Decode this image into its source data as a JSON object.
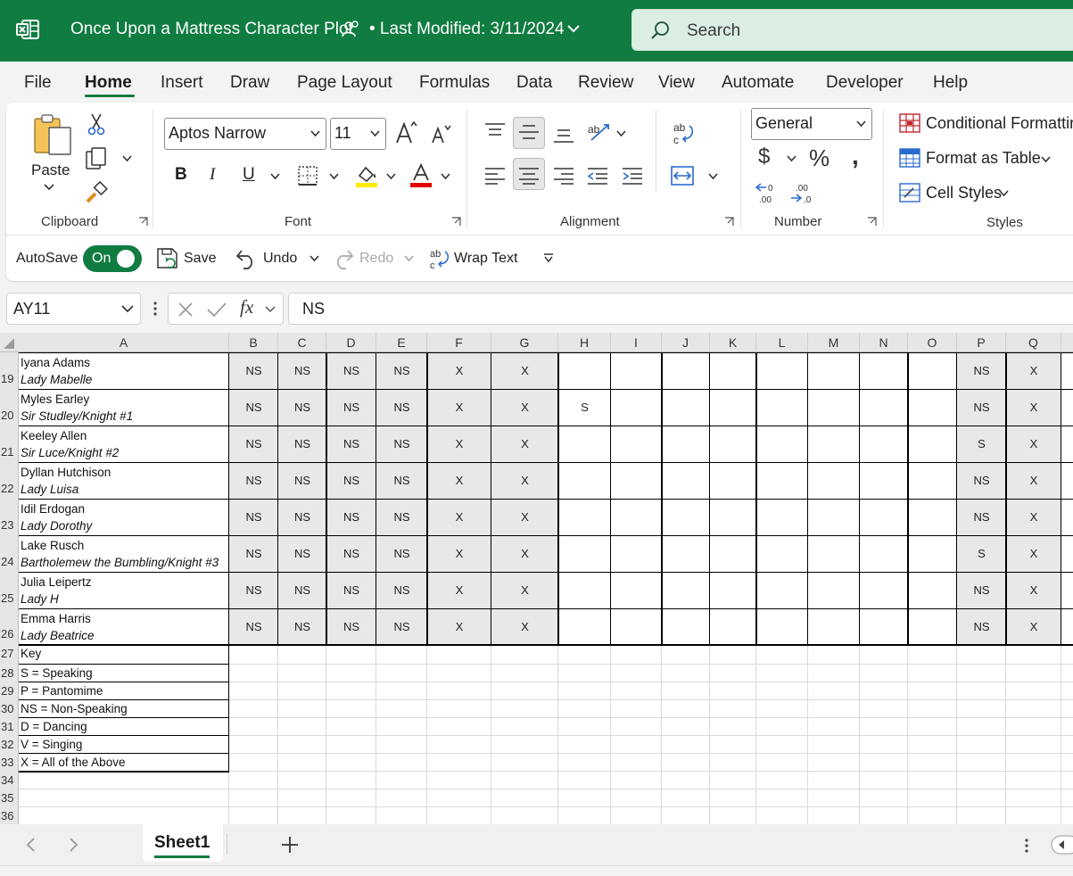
{
  "colors": {
    "brand": "#107c41",
    "shade": "#e8e8e8"
  },
  "titlebar": {
    "app_icon": "excel-icon",
    "title": "Once Upon a Mattress Character Plot",
    "modified": "• Last Modified: 3/11/2024",
    "search_placeholder": "Search"
  },
  "menu": [
    "File",
    "Home",
    "Insert",
    "Draw",
    "Page Layout",
    "Formulas",
    "Data",
    "Review",
    "View",
    "Automate",
    "Developer",
    "Help"
  ],
  "ribbon": {
    "clipboard": {
      "paste": "Paste",
      "label": "Clipboard"
    },
    "font": {
      "name": "Aptos Narrow",
      "size": "11",
      "label": "Font",
      "bold": "B",
      "italic": "I",
      "underline": "U"
    },
    "alignment": {
      "label": "Alignment"
    },
    "number": {
      "format": "General",
      "label": "Number"
    },
    "styles": {
      "conditional": "Conditional Formatting",
      "table": "Format as Table",
      "cell": "Cell Styles",
      "label": "Styles"
    }
  },
  "quickbar": {
    "autosave": "AutoSave",
    "toggle": "On",
    "save": "Save",
    "undo": "Undo",
    "redo": "Redo",
    "wrap": "Wrap Text"
  },
  "formula_bar": {
    "name_box": "AY11",
    "fx": "fx",
    "value": "NS"
  },
  "columns": [
    "A",
    "B",
    "C",
    "D",
    "E",
    "F",
    "G",
    "H",
    "I",
    "J",
    "K",
    "L",
    "M",
    "N",
    "O",
    "P",
    "Q"
  ],
  "rows": [
    {
      "num": "19",
      "actor": "Iyana Adams",
      "role": "Lady Mabelle",
      "values": [
        "NS",
        "NS",
        "NS",
        "NS",
        "X",
        "X",
        "",
        "",
        "",
        "",
        "",
        "",
        "",
        "",
        "NS",
        "X"
      ]
    },
    {
      "num": "20",
      "actor": "Myles Earley",
      "role": "Sir Studley/Knight #1",
      "values": [
        "NS",
        "NS",
        "NS",
        "NS",
        "X",
        "X",
        "S",
        "",
        "",
        "",
        "",
        "",
        "",
        "",
        "NS",
        "X"
      ]
    },
    {
      "num": "21",
      "actor": "Keeley Allen",
      "role": "Sir Luce/Knight #2",
      "values": [
        "NS",
        "NS",
        "NS",
        "NS",
        "X",
        "X",
        "",
        "",
        "",
        "",
        "",
        "",
        "",
        "",
        "S",
        "X"
      ]
    },
    {
      "num": "22",
      "actor": "Dyllan Hutchison",
      "role": "Lady Luisa",
      "values": [
        "NS",
        "NS",
        "NS",
        "NS",
        "X",
        "X",
        "",
        "",
        "",
        "",
        "",
        "",
        "",
        "",
        "NS",
        "X"
      ]
    },
    {
      "num": "23",
      "actor": "Idil Erdogan",
      "role": "Lady Dorothy",
      "values": [
        "NS",
        "NS",
        "NS",
        "NS",
        "X",
        "X",
        "",
        "",
        "",
        "",
        "",
        "",
        "",
        "",
        "NS",
        "X"
      ]
    },
    {
      "num": "24",
      "actor": "Lake Rusch",
      "role": "Bartholemew the Bumbling/Knight #3",
      "values": [
        "NS",
        "NS",
        "NS",
        "NS",
        "X",
        "X",
        "",
        "",
        "",
        "",
        "",
        "",
        "",
        "",
        "S",
        "X"
      ]
    },
    {
      "num": "25",
      "actor": "Julia Leipertz",
      "role": "Lady H",
      "values": [
        "NS",
        "NS",
        "NS",
        "NS",
        "X",
        "X",
        "",
        "",
        "",
        "",
        "",
        "",
        "",
        "",
        "NS",
        "X"
      ]
    },
    {
      "num": "26",
      "actor": "Emma Harris",
      "role": "Lady Beatrice",
      "values": [
        "NS",
        "NS",
        "NS",
        "NS",
        "X",
        "X",
        "",
        "",
        "",
        "",
        "",
        "",
        "",
        "",
        "NS",
        "X"
      ]
    }
  ],
  "key_rows": [
    {
      "num": "27",
      "text": "Key"
    },
    {
      "num": "28",
      "text": "S = Speaking"
    },
    {
      "num": "29",
      "text": "P = Pantomime"
    },
    {
      "num": "30",
      "text": "NS = Non-Speaking"
    },
    {
      "num": "31",
      "text": "D = Dancing"
    },
    {
      "num": "32",
      "text": "V = Singing"
    },
    {
      "num": "33",
      "text": "X = All of the Above"
    },
    {
      "num": "34",
      "text": ""
    },
    {
      "num": "35",
      "text": ""
    },
    {
      "num": "36",
      "text": ""
    }
  ],
  "sheets": [
    "Sheet1"
  ]
}
